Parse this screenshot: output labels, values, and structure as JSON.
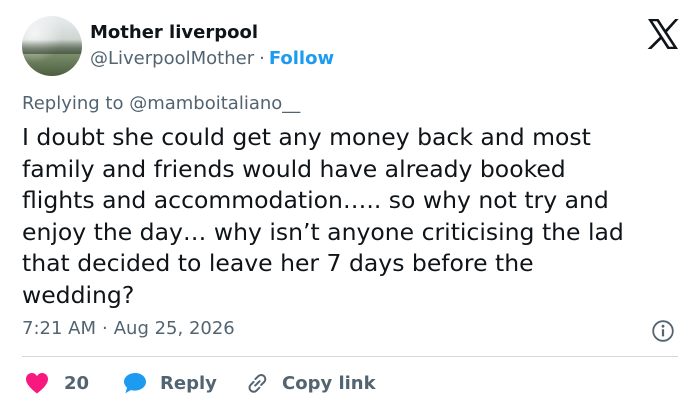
{
  "author": {
    "name": "Mother liverpool",
    "handle": "@LiverpoolMother",
    "separator": "·",
    "follow_label": "Follow"
  },
  "reply_context": {
    "prefix": "Replying to ",
    "mention": "@mamboitaliano__"
  },
  "tweet": {
    "text": "I doubt she could get any money back and most\nfamily and friends would have already booked\nflights and accommodation….. so why not try and\nenjoy the day… why isn’t anyone criticising the lad\nthat decided to leave her 7 days before the\nwedding?",
    "time": "7:21 AM",
    "separator": "·",
    "date": "Aug 25, 2026"
  },
  "actions": {
    "like_count": "20",
    "reply_label": "Reply",
    "copy_link_label": "Copy link"
  },
  "icons": {
    "logo": "x-logo-icon",
    "info": "info-icon",
    "like": "heart-icon",
    "reply": "speech-bubble-icon",
    "copy_link": "link-icon"
  },
  "colors": {
    "accent": "#1d9bf0",
    "like": "#f91880",
    "text_primary": "#0f1419",
    "text_secondary": "#536471",
    "divider": "#cfd9de"
  }
}
